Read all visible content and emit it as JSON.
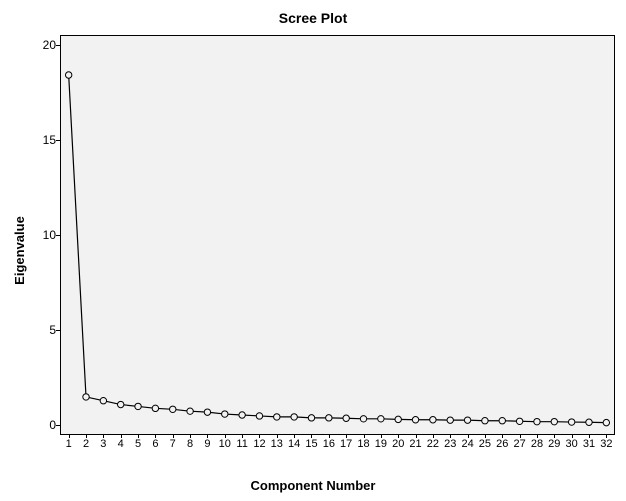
{
  "chart_data": {
    "type": "line",
    "title": "Scree Plot",
    "xlabel": "Component Number",
    "ylabel": "Eigenvalue",
    "xlim": [
      0.5,
      32.5
    ],
    "ylim": [
      -0.5,
      20.5
    ],
    "y_ticks": [
      0,
      5,
      10,
      15,
      20
    ],
    "x_ticks": [
      1,
      2,
      3,
      4,
      5,
      6,
      7,
      8,
      9,
      10,
      11,
      12,
      13,
      14,
      15,
      16,
      17,
      18,
      19,
      20,
      21,
      22,
      23,
      24,
      25,
      26,
      27,
      28,
      29,
      30,
      31,
      32
    ],
    "series": [
      {
        "name": "Eigenvalues",
        "marker": "circle-open",
        "x": [
          1,
          2,
          3,
          4,
          5,
          6,
          7,
          8,
          9,
          10,
          11,
          12,
          13,
          14,
          15,
          16,
          17,
          18,
          19,
          20,
          21,
          22,
          23,
          24,
          25,
          26,
          27,
          28,
          29,
          30,
          31,
          32
        ],
        "values": [
          18.4,
          1.5,
          1.3,
          1.1,
          1.0,
          0.9,
          0.85,
          0.75,
          0.7,
          0.6,
          0.55,
          0.5,
          0.45,
          0.45,
          0.4,
          0.4,
          0.38,
          0.35,
          0.35,
          0.32,
          0.3,
          0.3,
          0.28,
          0.28,
          0.25,
          0.25,
          0.22,
          0.2,
          0.2,
          0.18,
          0.17,
          0.15
        ]
      }
    ]
  }
}
